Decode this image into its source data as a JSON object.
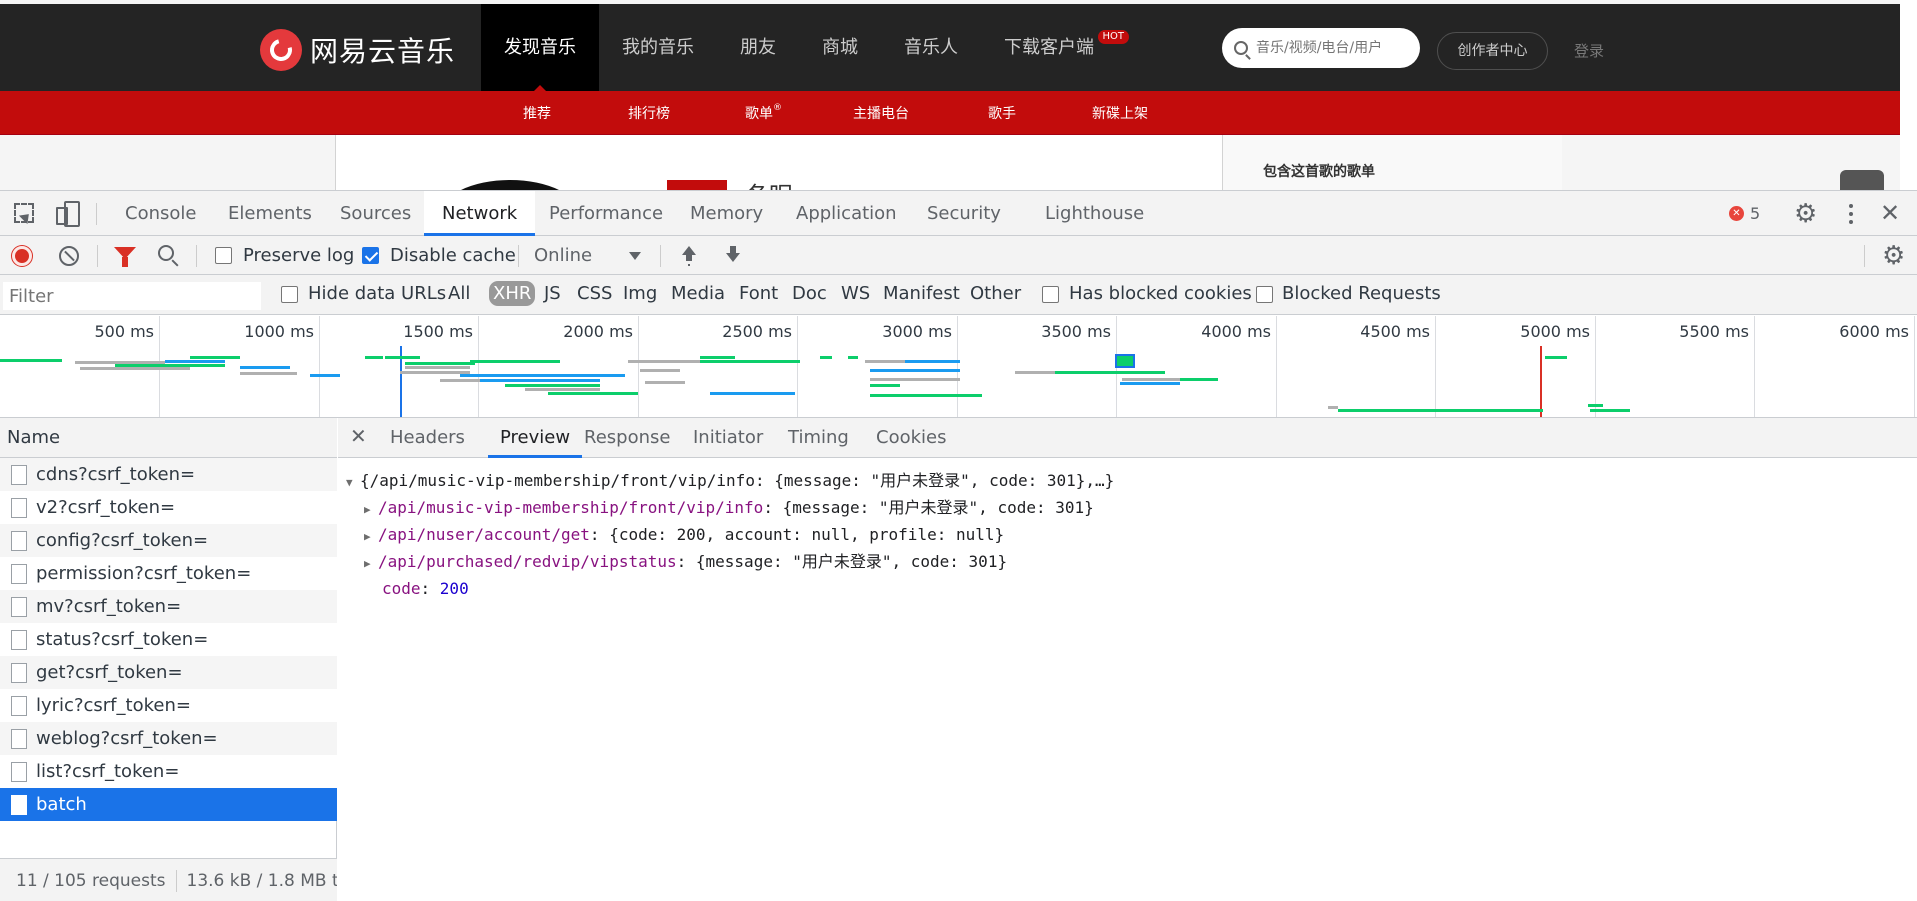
{
  "site": {
    "logo_text": "网易云音乐",
    "nav": [
      "发现音乐",
      "我的音乐",
      "朋友",
      "商城",
      "音乐人",
      "下载客户端"
    ],
    "hot_badge": "HOT",
    "search_placeholder": "音乐/视频/电台/用户",
    "creator_button": "创作者中心",
    "login": "登录",
    "subnav": [
      "推荐",
      "排行榜",
      "歌单",
      "主播电台",
      "歌手",
      "新碟上架"
    ],
    "subnav_sup": "®",
    "side_title": "包含这首歌的歌单",
    "song_title": "冬眠"
  },
  "devtools": {
    "tabs": [
      "Console",
      "Elements",
      "Sources",
      "Network",
      "Performance",
      "Memory",
      "Application",
      "Security",
      "Lighthouse"
    ],
    "active_tab": "Network",
    "error_count": "5",
    "toolbar": {
      "preserve_log": "Preserve log",
      "disable_cache": "Disable cache",
      "throttle": "Online"
    },
    "filterbar": {
      "placeholder": "Filter",
      "hide_data_urls": "Hide data URLs",
      "types": [
        "All",
        "XHR",
        "JS",
        "CSS",
        "Img",
        "Media",
        "Font",
        "Doc",
        "WS",
        "Manifest",
        "Other"
      ],
      "active_type": "XHR",
      "has_blocked_cookies": "Has blocked cookies",
      "blocked_requests": "Blocked Requests"
    },
    "overview_ticks": [
      "500 ms",
      "1000 ms",
      "1500 ms",
      "2000 ms",
      "2500 ms",
      "3000 ms",
      "3500 ms",
      "4000 ms",
      "4500 ms",
      "5000 ms",
      "5500 ms",
      "6000 ms"
    ],
    "name_header": "Name",
    "requests": [
      "cdns?csrf_token=",
      "v2?csrf_token=",
      "config?csrf_token=",
      "permission?csrf_token=",
      "mv?csrf_token=",
      "status?csrf_token=",
      "get?csrf_token=",
      "lyric?csrf_token=",
      "weblog?csrf_token=",
      "list?csrf_token=",
      "batch"
    ],
    "selected_request": "batch",
    "status": {
      "requests": "11 / 105 requests",
      "size": "13.6 kB / 1.8 MB t"
    },
    "detail_tabs": [
      "Headers",
      "Preview",
      "Response",
      "Initiator",
      "Timing",
      "Cookies"
    ],
    "active_detail_tab": "Preview",
    "preview": {
      "root": "{/api/music-vip-membership/front/vip/info: {message: \"用户未登录\", code: 301},…}",
      "entries": [
        {
          "key": "/api/music-vip-membership/front/vip/info",
          "value": "{message: \"用户未登录\", code: 301}"
        },
        {
          "key": "/api/nuser/account/get",
          "value": "{code: 200, account: null, profile: null}"
        },
        {
          "key": "/api/purchased/redvip/vipstatus",
          "value": "{message: \"用户未登录\", code: 301}"
        }
      ],
      "code_key": "code",
      "code_value": "200"
    }
  }
}
